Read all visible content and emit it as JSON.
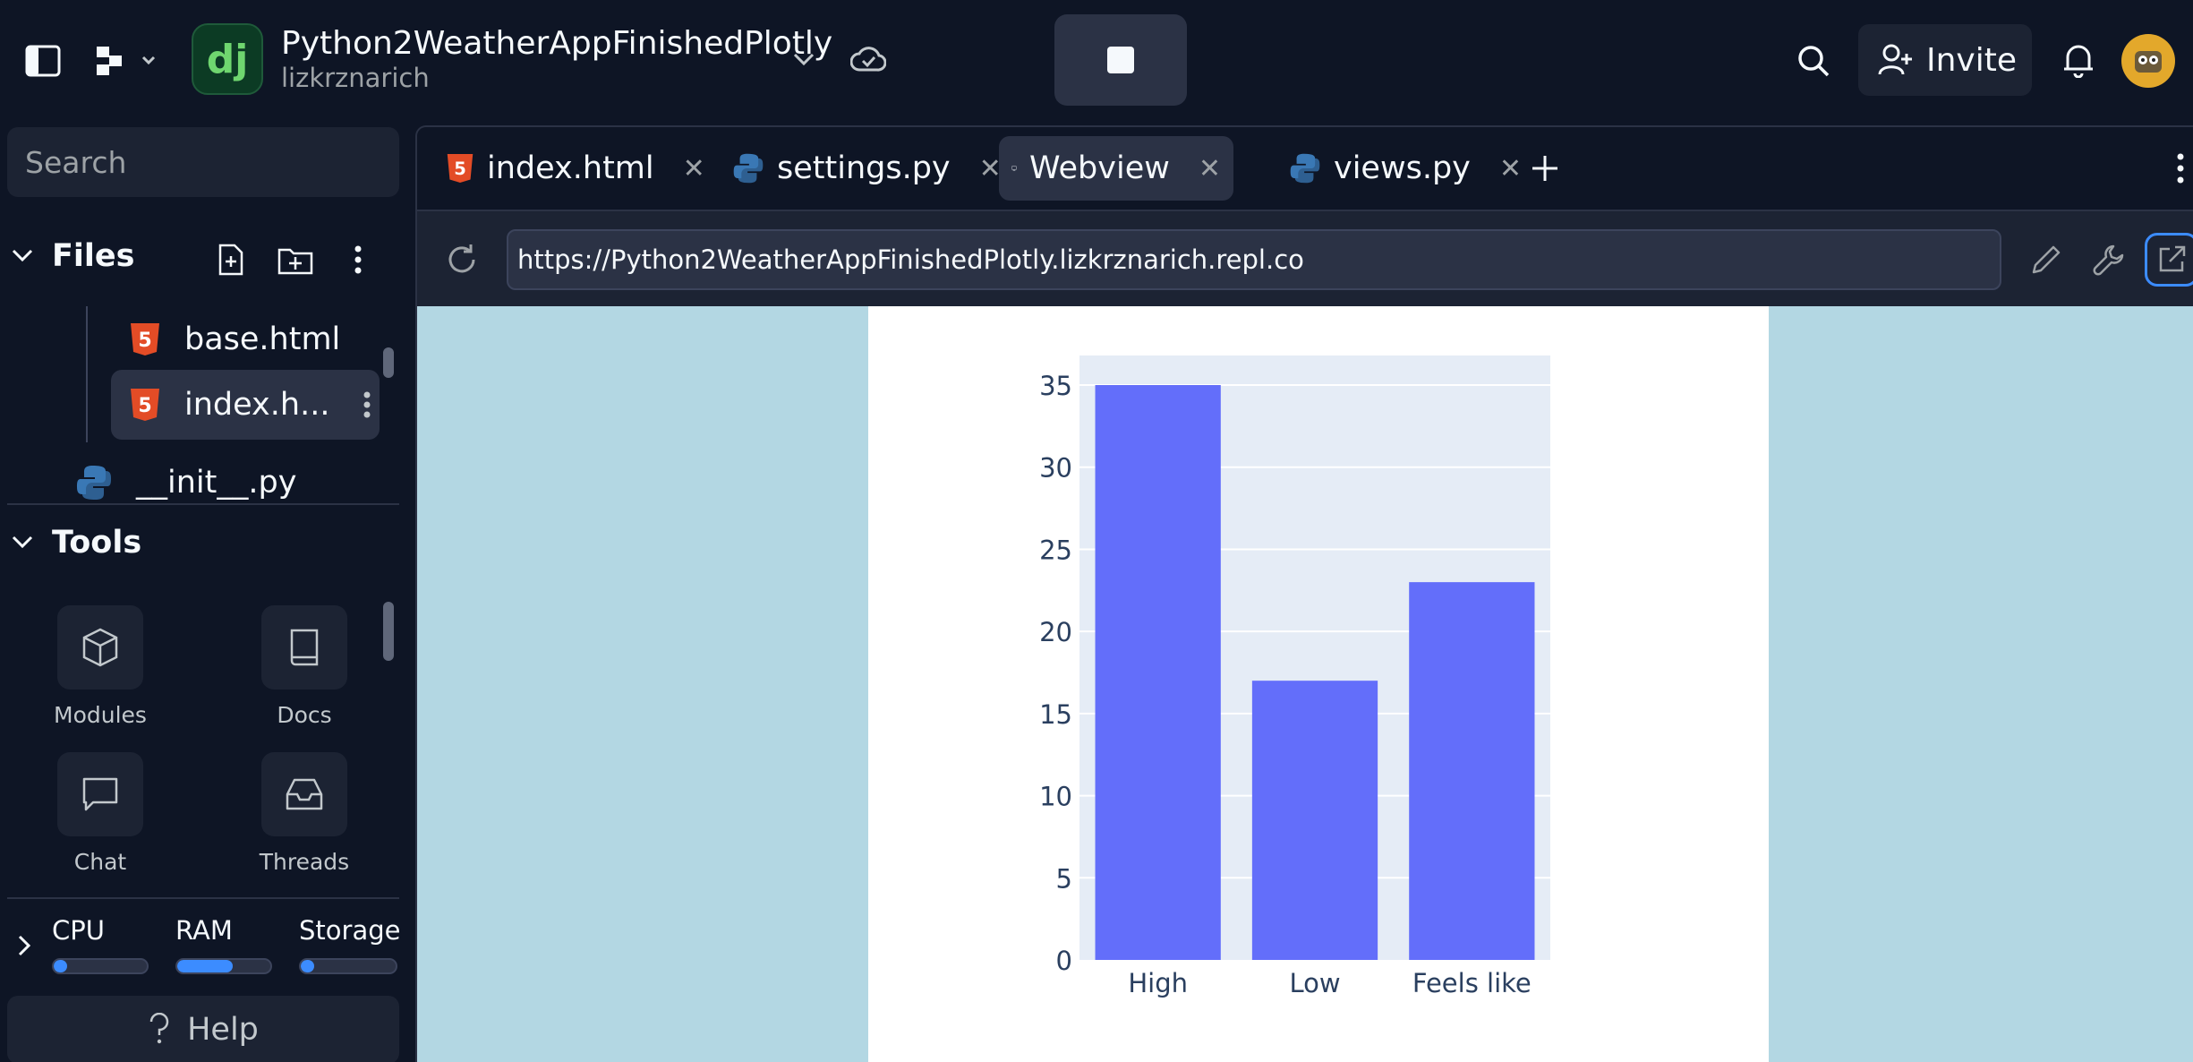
{
  "topbar": {
    "repl_logo_text": "dj",
    "repl_title": "Python2WeatherAppFinishedPlotly",
    "repl_owner": "lizkrznarich",
    "invite_label": "Invite"
  },
  "sidebar": {
    "search_placeholder": "Search",
    "files_label": "Files",
    "files": [
      {
        "name": "base.html",
        "icon": "html-icon"
      },
      {
        "name": "index.h...",
        "icon": "html-icon"
      },
      {
        "name": "__init__.py",
        "icon": "python-icon"
      }
    ],
    "tools_label": "Tools",
    "tools": [
      {
        "label": "Modules",
        "icon": "cube-icon"
      },
      {
        "label": "Docs",
        "icon": "book-icon"
      },
      {
        "label": "Chat",
        "icon": "chat-icon"
      },
      {
        "label": "Threads",
        "icon": "inbox-icon"
      }
    ],
    "resources": [
      {
        "label": "CPU",
        "usage": 0.05
      },
      {
        "label": "RAM",
        "usage": 0.6
      },
      {
        "label": "Storage",
        "usage": 0.05
      }
    ],
    "help_label": "Help"
  },
  "tabs": [
    {
      "label": "index.html",
      "icon": "html-icon",
      "active": false
    },
    {
      "label": "settings.py",
      "icon": "python-icon",
      "active": false
    },
    {
      "label": "Webview",
      "icon": "monitor-icon",
      "active": true
    },
    {
      "label": "views.py",
      "icon": "python-icon",
      "active": false
    }
  ],
  "webview": {
    "url": "https://Python2WeatherAppFinishedPlotly.lizkrznarich.repl.co"
  },
  "chart_data": {
    "type": "bar",
    "categories": [
      "High",
      "Low",
      "Feels like"
    ],
    "values": [
      35,
      17,
      23
    ],
    "ylim": [
      0,
      36.8
    ],
    "yticks": [
      0,
      5,
      10,
      15,
      20,
      25,
      30,
      35
    ],
    "bar_color": "#636efa",
    "plot_bg": "#e5ecf6",
    "grid": true
  },
  "colors": {
    "app_bg": "#0e1525",
    "surface": "#1c2333",
    "accent": "#3c8cff",
    "webview_bg": "#b3d7e3"
  }
}
